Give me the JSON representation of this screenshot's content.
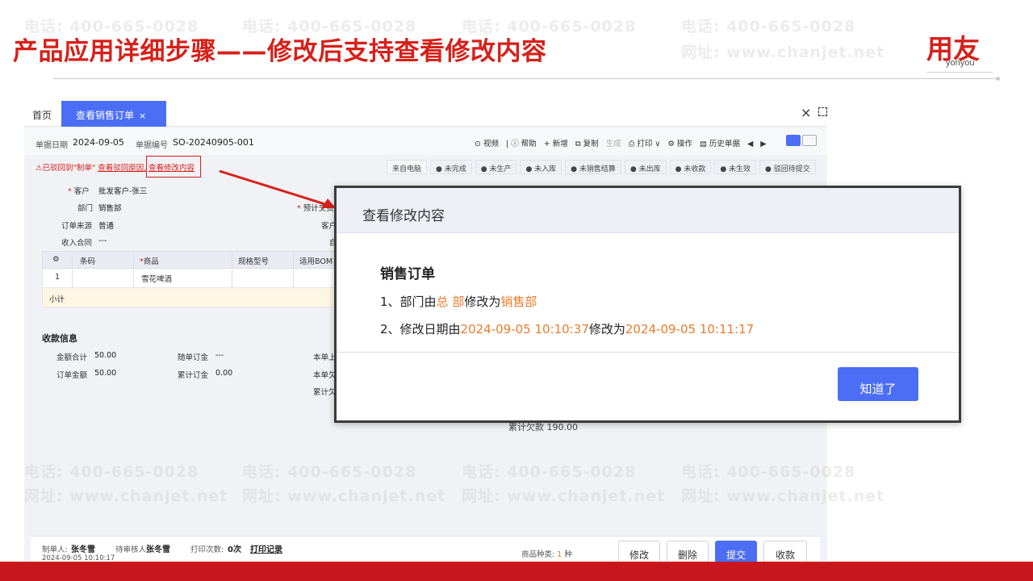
{
  "slide": {
    "title": "产品应用详细步骤——修改后支持查看修改内容",
    "logo_main": "用友",
    "logo_sub": "yonyou"
  },
  "app": {
    "tabs": {
      "home": "首页",
      "active": "查看销售订单",
      "active_close": "×"
    },
    "window": {
      "close": "×"
    },
    "doc": {
      "date_label": "单据日期",
      "date": "2024-09-05",
      "no_label": "单据编号",
      "no": "SO-20240905-001"
    },
    "toolbar": [
      "⊙ 视频",
      "| ⓘ 帮助",
      "+ 新增",
      "⧉ 复制",
      "生成",
      "⎙ 打印 ∨",
      "⚙ 操作",
      "▤ 历史单据",
      "◀",
      "▶"
    ],
    "warning": {
      "text": "⚠已驳回到\"制单\" ",
      "link1": "查看驳回原因,",
      "link2": "查看修改内容"
    },
    "status_buttons": [
      "来自电脑",
      "● 未完成",
      "● 未生产",
      "● 未入库",
      "● 未销售结算",
      "● 未出库",
      "● 未收款",
      "● 未生效",
      "● 驳回待提交"
    ],
    "form": {
      "customer_label": "客户",
      "customer": "批发客户-张三",
      "dept_label": "部门",
      "dept": "销售部",
      "source_label": "订单来源",
      "source": "普通",
      "contract_label": "收入合同",
      "contract": "---",
      "delivery_label": "预计交货",
      "cust2_label": "客户",
      "auto_label": "自"
    },
    "grid": {
      "headers": [
        "⚙",
        "条码",
        "商品",
        "规格型号",
        "适用BOM"
      ],
      "row": {
        "no": "1",
        "product": "雪花啤酒"
      },
      "subtotal": "小计"
    },
    "summary": {
      "title": "收款信息",
      "items": [
        {
          "label": "金额合计",
          "value": "50.00"
        },
        {
          "label": "随单订金",
          "value": "---"
        },
        {
          "label": "本单上"
        },
        {
          "label": "订单金额",
          "value": "50.00"
        },
        {
          "label": "累计订金",
          "value": "0.00"
        },
        {
          "label": "本单欠"
        },
        {
          "label": "累计欠"
        }
      ]
    },
    "hidden_text": "累计欠款    190.00",
    "footer": {
      "maker_label": "制单人:",
      "maker": "张冬雪",
      "reviewer_label": "待审核人:",
      "reviewer": "张冬雪",
      "print_count_label": "打印次数:",
      "print_count": "0次",
      "print_log": "打印记录",
      "time": "2024-09-05 10:10:17",
      "kinds_label": "商品种类:",
      "kinds_num": "1",
      "kinds_unit": "种",
      "buttons": [
        "修改",
        "删除",
        "提交",
        "收款"
      ]
    }
  },
  "modal": {
    "title": "查看修改内容",
    "section": "销售订单",
    "line1": {
      "prefix": "1、部门由",
      "old": "总 部",
      "mid": "修改为",
      "new": "销售部"
    },
    "line2": {
      "prefix": "2、修改日期由",
      "old": "2024-09-05 10:10:37",
      "mid": "修改为",
      "new": "2024-09-05 10:11:17"
    },
    "ok_button": "知道了"
  },
  "watermark": {
    "phone": "电话: 400-665-0028",
    "site": "网址: www.chanjet.net"
  },
  "colors": {
    "brand_red": "#d7201a",
    "primary_blue": "#4b6ef5",
    "highlight_orange": "#e97c2c",
    "band_red": "#c8161d"
  }
}
